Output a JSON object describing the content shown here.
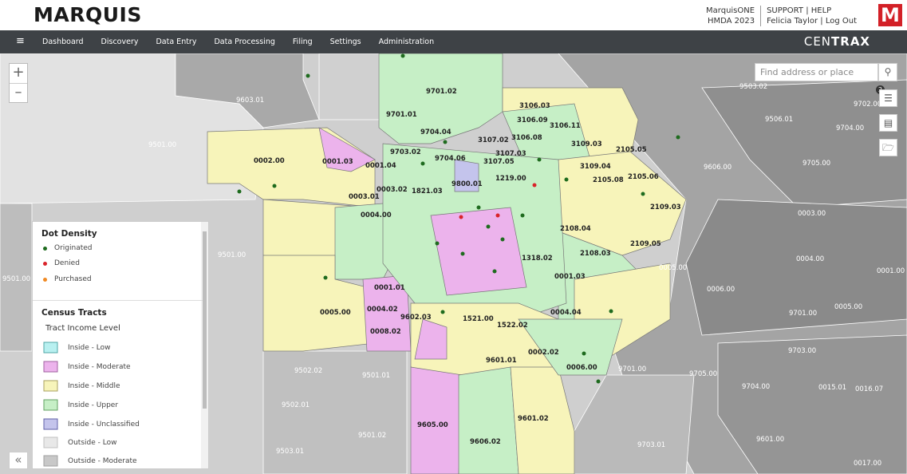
{
  "header": {
    "logo_text": "MARQUIS",
    "product": "MarquisONE",
    "dataset": "HMDA 2023",
    "support": "SUPPORT",
    "help": "HELP",
    "user": "Felicia Taylor",
    "logout": "Log Out",
    "badge_letter": "M"
  },
  "nav": {
    "menu_icon": "≡",
    "items": [
      "Dashboard",
      "Discovery",
      "Data Entry",
      "Data Processing",
      "Filing",
      "Settings",
      "Administration"
    ],
    "brand_light": "CEN",
    "brand_bold": "TRAX"
  },
  "map": {
    "search_placeholder": "Find address or place",
    "layer_badge": "2",
    "zoom_in": "+",
    "zoom_out": "–",
    "icons": [
      "search-icon",
      "layers-icon",
      "save-icon",
      "folder-icon"
    ]
  },
  "legend": {
    "dot_density_title": "Dot Density",
    "dots": [
      {
        "label": "Originated",
        "color": "#1e6b1e"
      },
      {
        "label": "Denied",
        "color": "#d9232a"
      },
      {
        "label": "Purchased",
        "color": "#f08a24"
      }
    ],
    "census_title": "Census Tracts",
    "income_title": "Tract Income Level",
    "levels": [
      {
        "label": "Inside - Low",
        "color": "#b8f0f0"
      },
      {
        "label": "Inside - Moderate",
        "color": "#ecb3ec"
      },
      {
        "label": "Inside - Middle",
        "color": "#f7f4ba"
      },
      {
        "label": "Inside - Upper",
        "color": "#c6efc6"
      },
      {
        "label": "Inside - Unclassified",
        "color": "#c4c4ec"
      },
      {
        "label": "Outside - Low",
        "color": "#e8e8e8"
      },
      {
        "label": "Outside - Moderate",
        "color": "#c8c8c8"
      }
    ],
    "collapse_icon": "«"
  },
  "tracts": [
    {
      "id": "9701.02",
      "c": "#c6efc6"
    },
    {
      "id": "9701.01",
      "c": "#c6efc6"
    },
    {
      "id": "9704.04",
      "c": "#c6efc6"
    },
    {
      "id": "9703.02",
      "c": "#c6efc6"
    },
    {
      "id": "9704.06",
      "c": "#c6efc6"
    },
    {
      "id": "3107.02",
      "c": "#c6efc6"
    },
    {
      "id": "3106.03",
      "c": "#f7f4ba"
    },
    {
      "id": "3106.09",
      "c": "#ecb3ec"
    },
    {
      "id": "3106.11",
      "c": "#f7f4ba"
    },
    {
      "id": "3106.08",
      "c": "#f7f4ba"
    },
    {
      "id": "3109.03",
      "c": "#c6efc6"
    },
    {
      "id": "2105.05",
      "c": "#ecb3ec"
    },
    {
      "id": "3107.03",
      "c": "#f7f4ba"
    },
    {
      "id": "3107.05",
      "c": "#c6efc6"
    },
    {
      "id": "3109.04",
      "c": "#c6efc6"
    },
    {
      "id": "1821.03",
      "c": "#c6efc6"
    },
    {
      "id": "9800.01",
      "c": "#c4c4ec"
    },
    {
      "id": "1219.00",
      "c": "#c6efc6"
    },
    {
      "id": "2105.08",
      "c": "#f7f4ba"
    },
    {
      "id": "2105.06",
      "c": "#f7f4ba"
    },
    {
      "id": "2109.03",
      "c": "#f7f4ba"
    },
    {
      "id": "0002.00",
      "c": "#f7f4ba"
    },
    {
      "id": "0001.03",
      "c": "#ecb3ec"
    },
    {
      "id": "0001.04",
      "c": "#f7f4ba"
    },
    {
      "id": "0003.02",
      "c": "#f7f4ba"
    },
    {
      "id": "0003.01",
      "c": "#c6efc6"
    },
    {
      "id": "0004.00",
      "c": "#f7f4ba"
    },
    {
      "id": "2108.04",
      "c": "#f7f4ba"
    },
    {
      "id": "2109.05",
      "c": "#f7f4ba"
    },
    {
      "id": "2108.03",
      "c": "#c6efc6"
    },
    {
      "id": "1318.02",
      "c": "#ecb3ec"
    },
    {
      "id": "0001.01",
      "c": "#ecb3ec"
    },
    {
      "id": "0004.02",
      "c": "#ecb3ec"
    },
    {
      "id": "0008.02",
      "c": "#ecb3ec"
    },
    {
      "id": "0005.00",
      "c": "#f7f4ba"
    },
    {
      "id": "9602.03",
      "c": "#ecb3ec"
    },
    {
      "id": "1521.00",
      "c": "#f7f4ba"
    },
    {
      "id": "1522.02",
      "c": "#f7f4ba"
    },
    {
      "id": "9601.01",
      "c": "#f7f4ba"
    },
    {
      "id": "9601.02",
      "c": "#f7f4ba"
    },
    {
      "id": "9605.00",
      "c": "#ecb3ec"
    },
    {
      "id": "9606.02",
      "c": "#c6efc6"
    },
    {
      "id": "0002.02",
      "c": "#c6efc6"
    },
    {
      "id": "0006.00",
      "c": "#c6efc6"
    },
    {
      "id": "0004.04",
      "c": "#c6efc6"
    },
    {
      "id": "0001.03",
      "c": "#c6efc6"
    }
  ]
}
